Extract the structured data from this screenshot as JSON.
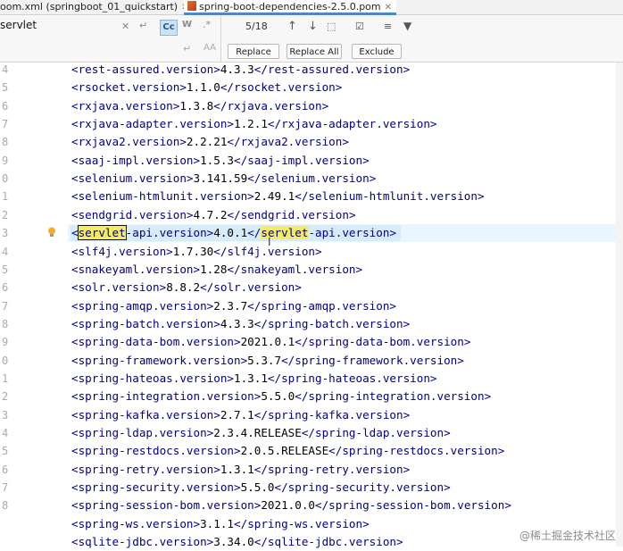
{
  "tabs": [
    {
      "label": "oom.xml (springboot_01_quickstart)",
      "closable": true,
      "active": false
    },
    {
      "label": "spring-boot-dependencies-2.5.0.pom",
      "closable": true,
      "active": true
    }
  ],
  "find": {
    "query": "servlet",
    "match_count": "5/18",
    "case_toggle": "Cc",
    "word_toggle": "W",
    "regex_toggle": ".*"
  },
  "replace": {
    "replace_label": "Replace",
    "replace_all_label": "Replace All",
    "exclude_label": "Exclude"
  },
  "editor": {
    "line_numbers": [
      "4",
      "5",
      "6",
      "7",
      "8",
      "9",
      "0",
      "1",
      "2",
      "3",
      "4",
      "5",
      "6",
      "7",
      "8",
      "9",
      "0",
      "1",
      "2",
      "3",
      "4",
      "5",
      "6",
      "7",
      "8"
    ],
    "lines": [
      {
        "tag": "rest-assured.version",
        "value": "4.3.3"
      },
      {
        "tag": "rsocket.version",
        "value": "1.1.0"
      },
      {
        "tag": "rxjava.version",
        "value": "1.3.8"
      },
      {
        "tag": "rxjava-adapter.version",
        "value": "1.2.1"
      },
      {
        "tag": "rxjava2.version",
        "value": "2.2.21"
      },
      {
        "tag": "saaj-impl.version",
        "value": "1.5.3"
      },
      {
        "tag": "selenium.version",
        "value": "3.141.59"
      },
      {
        "tag": "selenium-htmlunit.version",
        "value": "2.49.1"
      },
      {
        "tag": "sendgrid.version",
        "value": "4.7.2"
      },
      {
        "tag": "servlet-api.version",
        "value": "4.0.1",
        "highlight": true
      },
      {
        "tag": "slf4j.version",
        "value": "1.7.30"
      },
      {
        "tag": "snakeyaml.version",
        "value": "1.28"
      },
      {
        "tag": "solr.version",
        "value": "8.8.2"
      },
      {
        "tag": "spring-amqp.version",
        "value": "2.3.7"
      },
      {
        "tag": "spring-batch.version",
        "value": "4.3.3"
      },
      {
        "tag": "spring-data-bom.version",
        "value": "2021.0.1"
      },
      {
        "tag": "spring-framework.version",
        "value": "5.3.7"
      },
      {
        "tag": "spring-hateoas.version",
        "value": "1.3.1"
      },
      {
        "tag": "spring-integration.version",
        "value": "5.5.0"
      },
      {
        "tag": "spring-kafka.version",
        "value": "2.7.1"
      },
      {
        "tag": "spring-ldap.version",
        "value": "2.3.4.RELEASE"
      },
      {
        "tag": "spring-restdocs.version",
        "value": "2.0.5.RELEASE"
      },
      {
        "tag": "spring-retry.version",
        "value": "1.3.1"
      },
      {
        "tag": "spring-security.version",
        "value": "5.5.0"
      },
      {
        "tag": "spring-session-bom.version",
        "value": "2021.0.0"
      },
      {
        "tag": "spring-ws.version",
        "value": "3.1.1"
      },
      {
        "tag": "sqlite-jdbc.version",
        "value": "3.34.0"
      }
    ]
  },
  "watermark": "@稀土掘金技术社区",
  "colors": {
    "tag": "#000080",
    "value": "#000000",
    "match": "#f6ea5e",
    "tab_active_underline": "#4a88c7"
  }
}
